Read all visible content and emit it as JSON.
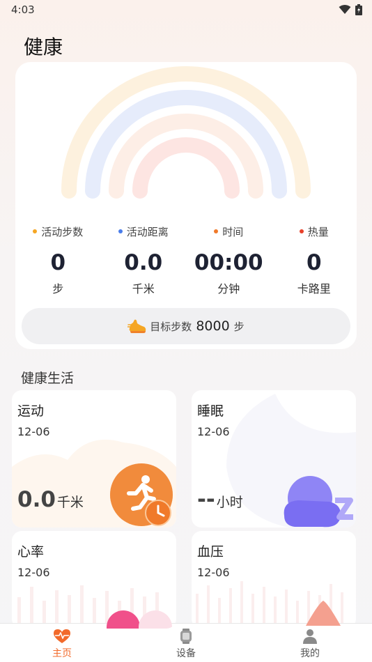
{
  "status": {
    "time": "4:03"
  },
  "page": {
    "title": "健康"
  },
  "summary": {
    "metrics": [
      {
        "label": "活动步数",
        "value": "0",
        "unit": "步",
        "color": "#f5a623"
      },
      {
        "label": "活动距离",
        "value": "0.0",
        "unit": "千米",
        "color": "#4a7dea"
      },
      {
        "label": "时间",
        "value": "00:00",
        "unit": "分钟",
        "color": "#f07a2a"
      },
      {
        "label": "热量",
        "value": "0",
        "unit": "卡路里",
        "color": "#e8412a"
      }
    ],
    "goal": {
      "label": "目标步数",
      "value": "8000",
      "unit": "步"
    }
  },
  "section": {
    "title": "健康生活"
  },
  "tiles": {
    "exercise": {
      "title": "运动",
      "date": "12-06",
      "value": "0.0",
      "unit": "千米"
    },
    "sleep": {
      "title": "睡眠",
      "date": "12-06",
      "value": "--",
      "unit": "小时"
    },
    "heart": {
      "title": "心率",
      "date": "12-06"
    },
    "pressure": {
      "title": "血压",
      "date": "12-06"
    }
  },
  "tabs": [
    {
      "label": "主页",
      "icon": "heart-pulse-icon",
      "active": true
    },
    {
      "label": "设备",
      "icon": "watch-icon",
      "active": false
    },
    {
      "label": "我的",
      "icon": "person-icon",
      "active": false
    }
  ],
  "colors": {
    "accent": "#f26a2b",
    "rainbow_outer": "#fdf1de",
    "rainbow_blue": "#e6ecfb",
    "rainbow_peach": "#fdeee6",
    "rainbow_inner": "#fde5e2"
  }
}
